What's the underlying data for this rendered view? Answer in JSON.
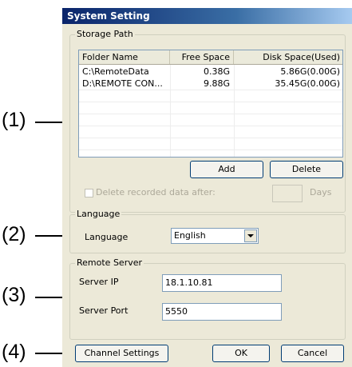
{
  "annotations": [
    "(1)",
    "(2)",
    "(3)",
    "(4)"
  ],
  "window": {
    "title": "System Setting"
  },
  "storage": {
    "group_label": "Storage Path",
    "columns": [
      "Folder Name",
      "Free Space",
      "Disk Space(Used)"
    ],
    "rows": [
      {
        "folder": "C:\\RemoteData",
        "free": "0.38G",
        "disk": "5.86G(0.00G)"
      },
      {
        "folder": "D:\\REMOTE CON...",
        "free": "9.88G",
        "disk": "35.45G(0.00G)"
      }
    ],
    "add_label": "Add",
    "delete_label": "Delete",
    "delete_recorded_label": "Delete recorded data after:",
    "days_label": "Days"
  },
  "language": {
    "group_label": "Language",
    "field_label": "Language",
    "selected": "English"
  },
  "remote": {
    "group_label": "Remote Server",
    "ip_label": "Server IP",
    "ip_value": "18.1.10.81",
    "port_label": "Server Port",
    "port_value": "5550"
  },
  "footer": {
    "channel_label": "Channel Settings",
    "ok_label": "OK",
    "cancel_label": "Cancel"
  }
}
